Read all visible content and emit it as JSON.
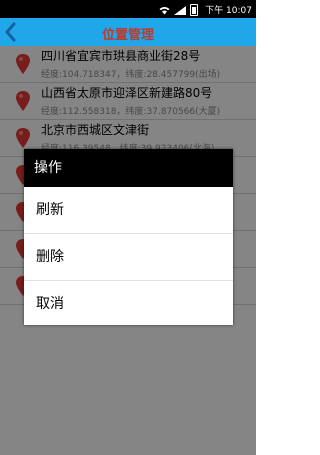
{
  "status_bar": {
    "time": "下午 10:07",
    "icons": [
      "wifi-icon",
      "signal-icon",
      "battery-icon"
    ]
  },
  "header": {
    "title": "位置管理",
    "back_icon": "back-arrow-icon"
  },
  "colors": {
    "header_bg": "#20a7ea",
    "title_color": "#c0392b",
    "pin_color": "#e53935"
  },
  "locations": [
    {
      "address": "四川省宜宾市珙县商业街28号",
      "coords": "经度:104.718347，纬度:28.457799(出场)"
    },
    {
      "address": "山西省太原市迎泽区新建路80号",
      "coords": "经度:112.558318，纬度:37.870566(大厦)"
    },
    {
      "address": "北京市西城区文津街",
      "coords": "经度:116.39548，纬度:39.923406(北海)"
    },
    {
      "address": "",
      "coords": ""
    },
    {
      "address": "",
      "coords": ""
    },
    {
      "address": "",
      "coords": ""
    },
    {
      "address": "",
      "coords": ""
    }
  ],
  "dialog": {
    "title": "操作",
    "options": [
      "刷新",
      "删除",
      "取消"
    ]
  }
}
